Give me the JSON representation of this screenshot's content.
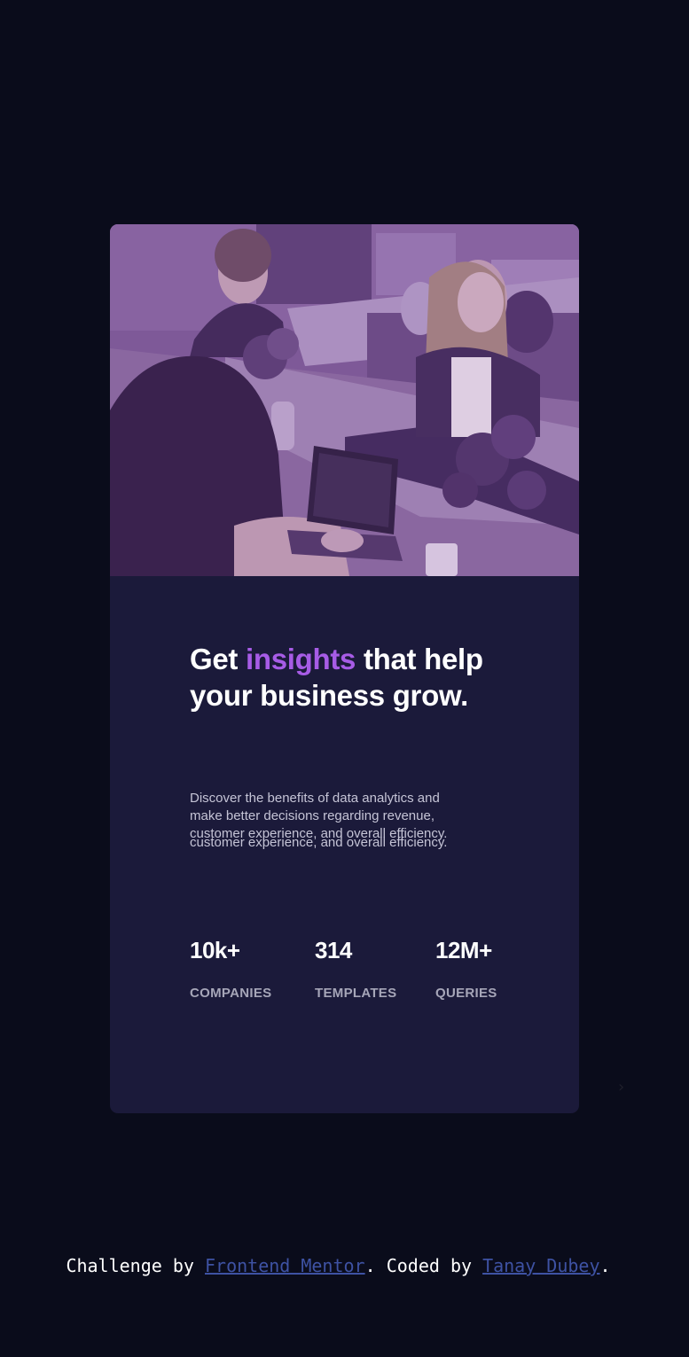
{
  "card": {
    "image_alt": "Women working at desks in an office",
    "headline": {
      "before": "Get ",
      "accent": "insights",
      "after": " that help your business grow."
    },
    "description": {
      "line1": "Discover the benefits of data analytics and",
      "line2": "make better decisions regarding revenue,",
      "line3": "customer experience, and overall efficiency."
    },
    "stats": [
      {
        "value": "10k+",
        "label": "COMPANIES"
      },
      {
        "value": "314",
        "label": "TEMPLATES"
      },
      {
        "value": "12M+",
        "label": "QUERIES"
      }
    ]
  },
  "attribution": {
    "prefix": "Challenge by ",
    "link1": "Frontend Mentor",
    "middle": ". Coded by ",
    "link2": "Tanay Dubey",
    "suffix": "."
  },
  "colors": {
    "page_bg": "#0a0c1b",
    "card_bg": "#1b1a3a",
    "accent": "#a75ce6",
    "image_overlay": "#7d5a96",
    "link": "#3e52a3"
  },
  "icons": {
    "chevron": "chevron-right-icon"
  }
}
